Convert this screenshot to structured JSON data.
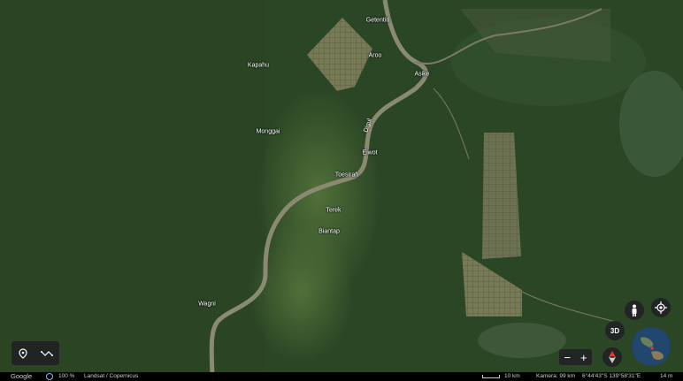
{
  "map": {
    "places": [
      {
        "id": "getentiri",
        "name": "Getentiri"
      },
      {
        "id": "aroo",
        "name": "Aroo"
      },
      {
        "id": "kapahu",
        "name": "Kapahu"
      },
      {
        "id": "asike",
        "name": "Asike"
      },
      {
        "id": "monggai",
        "name": "Monggai"
      },
      {
        "id": "eiwot",
        "name": "Eiwot"
      },
      {
        "id": "toesirah",
        "name": "Toesirah"
      },
      {
        "id": "terek",
        "name": "Terek"
      },
      {
        "id": "biantap",
        "name": "Biantap"
      },
      {
        "id": "wagni",
        "name": "Wagni"
      }
    ],
    "river_label": "Digul"
  },
  "controls": {
    "btn_3d": "3D",
    "zoom_out": "−",
    "zoom_in": "+",
    "icons": [
      "place-marker-icon",
      "measure-icon",
      "pegman-icon",
      "my-location-icon",
      "compass-icon",
      "globe-icon",
      "zoom-out-icon",
      "zoom-in-icon"
    ]
  },
  "status_bar": {
    "logo": "Google",
    "loading": "100 %",
    "attribution": "Landsat / Copernicus",
    "scale": "10 km",
    "camera": "Kamera: 99 km",
    "coordinates": "6°44'43\"S 139°58'31\"E",
    "elevation": "14 m"
  },
  "colors": {
    "forest": "#2d4a26",
    "river": "#8a8a73",
    "plantation": "#7a7a52",
    "ui_panel": "#202124"
  }
}
